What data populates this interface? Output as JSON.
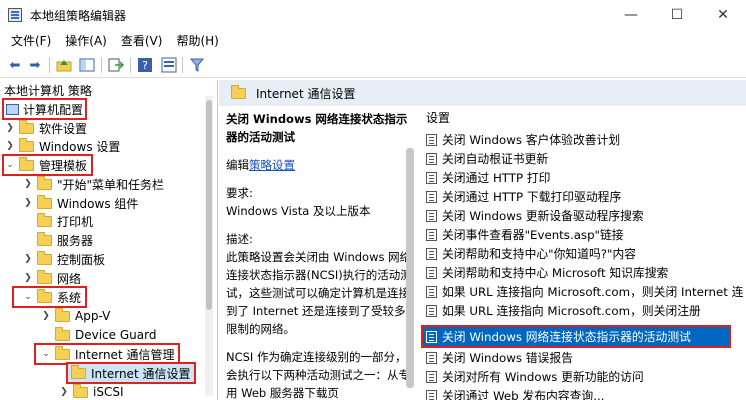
{
  "window": {
    "title": "本地组策略编辑器",
    "minimize": "—",
    "maximize": "☐",
    "close": "✕"
  },
  "menu": [
    "文件(F)",
    "操作(A)",
    "查看(V)",
    "帮助(H)"
  ],
  "toolbar": {
    "icons": [
      "back-arrow-icon",
      "forward-arrow-icon",
      "up-folder-icon",
      "show-tree-icon",
      "export-icon",
      "help-icon",
      "properties-icon",
      "filter-icon"
    ]
  },
  "tree": {
    "header": "本地计算机 策略",
    "items": [
      {
        "label": "计算机配置",
        "level": 0,
        "expanded": true,
        "highlight": true,
        "icon": "computer-icon"
      },
      {
        "label": "软件设置",
        "level": 1,
        "expanded": false
      },
      {
        "label": "Windows 设置",
        "level": 1,
        "expanded": false
      },
      {
        "label": "管理模板",
        "level": 1,
        "expanded": true,
        "highlight": true
      },
      {
        "label": "\"开始\"菜单和任务栏",
        "level": 2,
        "expanded": false
      },
      {
        "label": "Windows 组件",
        "level": 2,
        "expanded": false
      },
      {
        "label": "打印机",
        "level": 2,
        "expanded": null
      },
      {
        "label": "服务器",
        "level": 2,
        "expanded": null
      },
      {
        "label": "控制面板",
        "level": 2,
        "expanded": false
      },
      {
        "label": "网络",
        "level": 2,
        "expanded": false
      },
      {
        "label": "系统",
        "level": 2,
        "expanded": true,
        "highlight": true
      },
      {
        "label": "App-V",
        "level": 3,
        "expanded": false
      },
      {
        "label": "Device Guard",
        "level": 3,
        "expanded": null
      },
      {
        "label": "Internet 通信管理",
        "level": 3,
        "expanded": true,
        "highlight": true
      },
      {
        "label": "Internet 通信设置",
        "level": 4,
        "expanded": null,
        "highlight": true,
        "selected": true
      },
      {
        "label": "iSCSI",
        "level": 3,
        "expanded": false
      }
    ]
  },
  "right_header": "Internet 通信设置",
  "description": {
    "title": "关闭 Windows 网络连接状态指示器的活动测试",
    "edit_prefix": "编辑",
    "edit_link": "策略设置",
    "requirement_label": "要求:",
    "requirement_value": "Windows Vista 及以上版本",
    "desc_label": "描述:",
    "desc_text": "此策略设置会关闭由 Windows 网络连接状态指示器(NCSI)执行的活动测试，这些测试可以确定计算机是连接到了 Internet 还是连接到了受较多限制的网络。",
    "ncsi_text": "NCSI 作为确定连接级别的一部分，会执行以下两种活动测试之一：从专用 Web 服务器下载页"
  },
  "list": {
    "header": "设置",
    "items": [
      "关闭 Windows 客户体验改善计划",
      "关闭自动根证书更新",
      "关闭通过 HTTP 打印",
      "关闭通过 HTTP 下载打印驱动程序",
      "关闭 Windows 更新设备驱动程序搜索",
      "关闭事件查看器\"Events.asp\"链接",
      "关闭帮助和支持中心\"你知道吗?\"内容",
      "关闭帮助和支持中心 Microsoft 知识库搜索",
      "如果 URL 连接指向 Microsoft.com，则关闭 Internet 连",
      "如果 URL 连接指向 Microsoft.com，则关闭注册",
      "关闭 Windows 网络连接状态指示器的活动测试",
      "关闭 Windows 错误报告",
      "关闭对所有 Windows 更新功能的访问",
      "关闭通过 Web 发布内容查询..."
    ],
    "selected_index": 10
  },
  "colors": {
    "selection": "#0067c0",
    "highlight_box": "#e0201c",
    "header_band": "#e8eef6",
    "link": "#1a4fb5"
  }
}
